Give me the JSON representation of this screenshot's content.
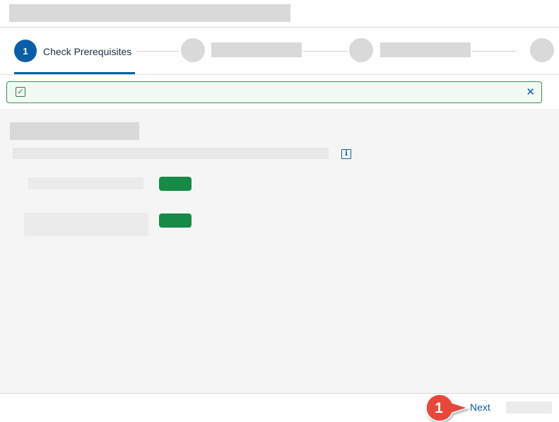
{
  "wizard": {
    "steps": [
      {
        "number": "1",
        "label": "Check Prerequisites",
        "active": true
      },
      {
        "number": "",
        "label": "",
        "active": false
      },
      {
        "number": "",
        "label": "",
        "active": false
      },
      {
        "number": "",
        "label": "",
        "active": false
      }
    ]
  },
  "message_strip": {
    "type": "success",
    "icon": "checkbox-icon",
    "close_icon": "close-icon",
    "close_glyph": "✕",
    "check_glyph": "✓"
  },
  "content": {
    "info_icon": "info-icon",
    "info_glyph": "i",
    "status_color": "#178a48"
  },
  "footer": {
    "next_label": "Next"
  },
  "annotation": {
    "callout_number": "1",
    "callout_color": "#e8473a"
  },
  "colors": {
    "accent": "#0a5ea8",
    "success_border": "#3a8f5e",
    "success_bg": "#f1fbf4",
    "placeholder": "#d9d9d9",
    "content_bg": "#f5f5f5"
  }
}
